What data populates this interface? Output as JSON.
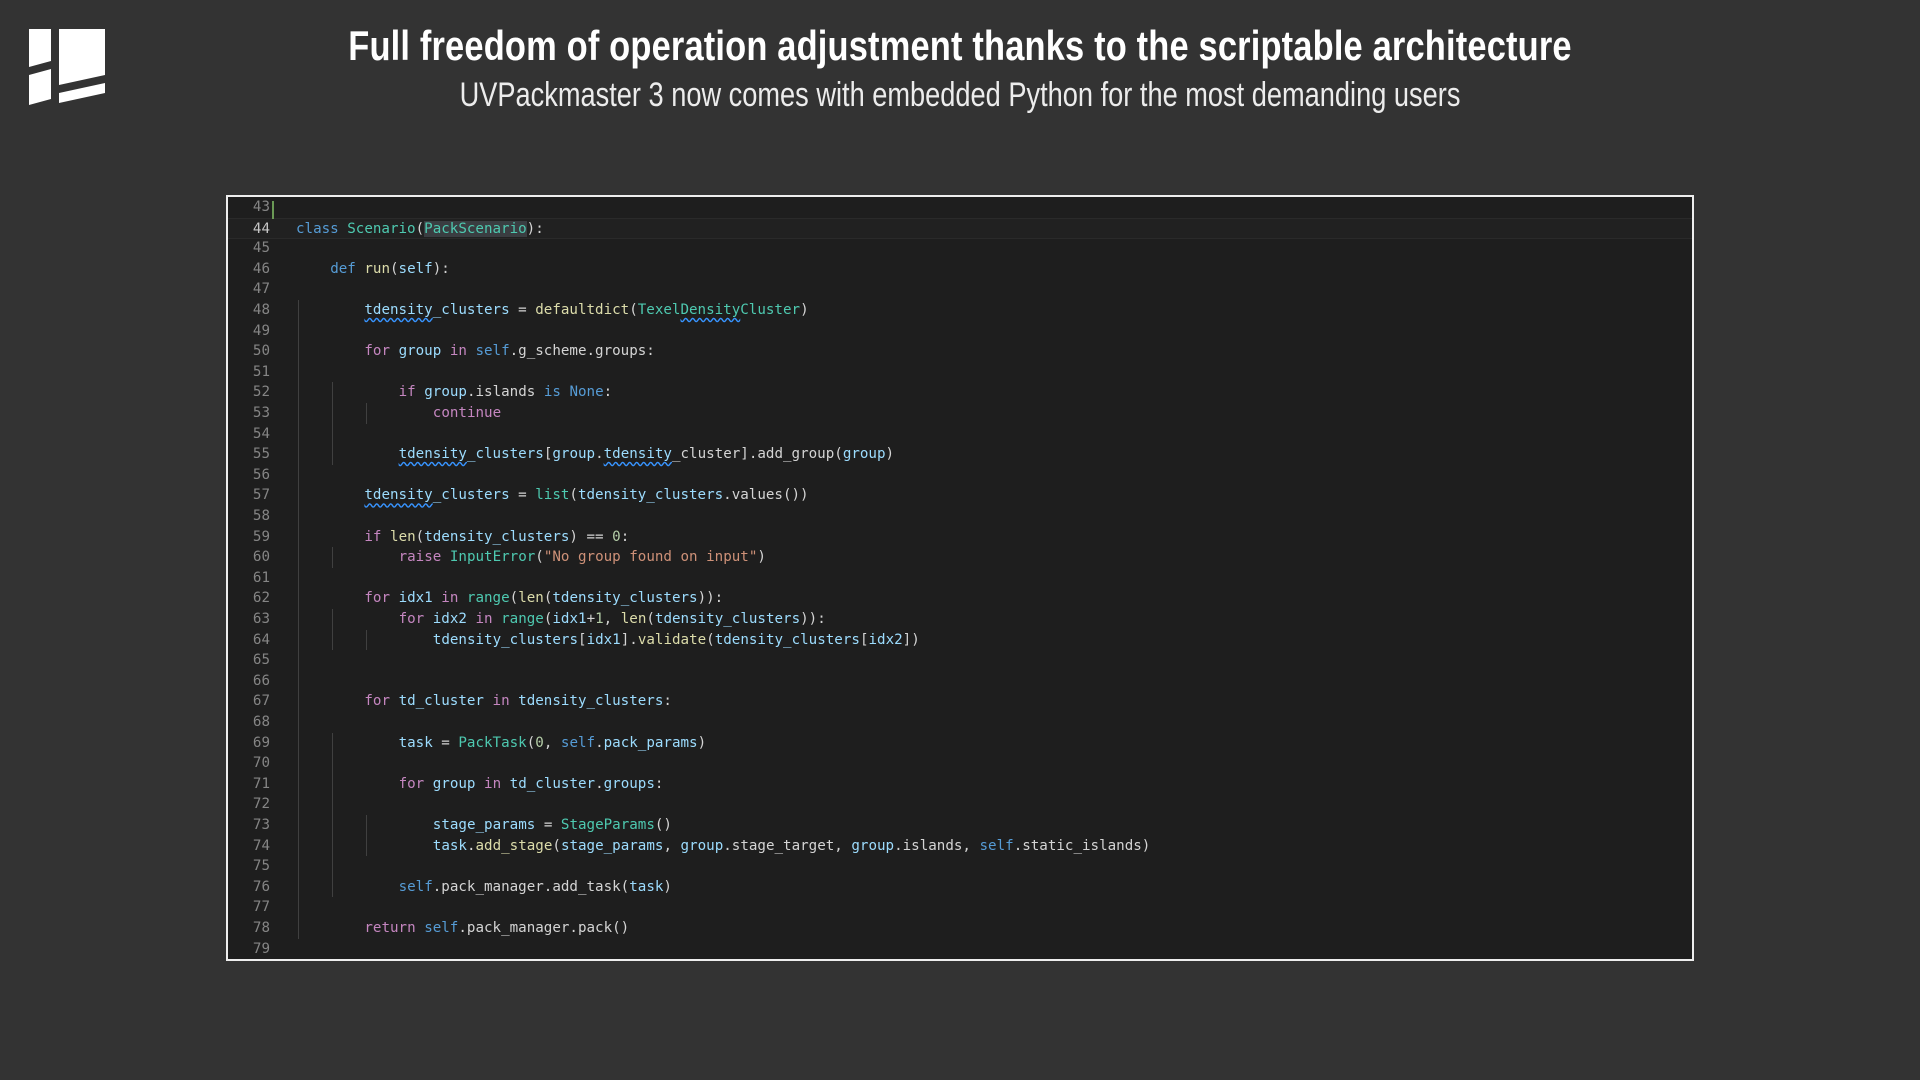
{
  "header": {
    "title": "Full freedom of operation adjustment thanks to the scriptable architecture",
    "subtitle": "UVPackmaster 3 now comes with embedded Python for the most demanding users"
  },
  "logo": {
    "icon": "uvpackmaster-logo-icon",
    "color": "#ffffff"
  },
  "editor": {
    "active_line": "44",
    "lines": [
      {
        "n": "43",
        "indent": 0,
        "tokens": []
      },
      {
        "n": "44",
        "indent": 0,
        "tokens": [
          [
            "kw",
            "class"
          ],
          [
            "pun",
            " "
          ],
          [
            "cls",
            "Scenario"
          ],
          [
            "pun",
            "("
          ],
          [
            "cls hl",
            "PackScenario"
          ],
          [
            "pun",
            "):"
          ]
        ]
      },
      {
        "n": "45",
        "indent": 0,
        "tokens": []
      },
      {
        "n": "46",
        "indent": 1,
        "tokens": [
          [
            "kw",
            "def"
          ],
          [
            "pun",
            " "
          ],
          [
            "fn",
            "run"
          ],
          [
            "pun",
            "("
          ],
          [
            "var",
            "self"
          ],
          [
            "pun",
            "):"
          ]
        ]
      },
      {
        "n": "47",
        "indent": 0,
        "tokens": []
      },
      {
        "n": "48",
        "indent": 2,
        "tokens": [
          [
            "var sq",
            "tdensity"
          ],
          [
            "var",
            "_clusters"
          ],
          [
            "pun",
            " = "
          ],
          [
            "fn",
            "defaultdict"
          ],
          [
            "pun",
            "("
          ],
          [
            "cls",
            "Texel"
          ],
          [
            "cls sq",
            "Density"
          ],
          [
            "cls",
            "Cluster"
          ],
          [
            "pun",
            ")"
          ]
        ]
      },
      {
        "n": "49",
        "indent": 0,
        "tokens": []
      },
      {
        "n": "50",
        "indent": 2,
        "tokens": [
          [
            "ctl",
            "for"
          ],
          [
            "pun",
            " "
          ],
          [
            "var",
            "group"
          ],
          [
            "pun",
            " "
          ],
          [
            "ctl",
            "in"
          ],
          [
            "pun",
            " "
          ],
          [
            "kw",
            "self"
          ],
          [
            "pun",
            ".g_scheme.groups:"
          ]
        ]
      },
      {
        "n": "51",
        "indent": 0,
        "tokens": []
      },
      {
        "n": "52",
        "indent": 3,
        "tokens": [
          [
            "ctl",
            "if"
          ],
          [
            "pun",
            " "
          ],
          [
            "var",
            "group"
          ],
          [
            "pun",
            ".islands "
          ],
          [
            "kw",
            "is"
          ],
          [
            "pun",
            " "
          ],
          [
            "kw",
            "None"
          ],
          [
            "pun",
            ":"
          ]
        ]
      },
      {
        "n": "53",
        "indent": 4,
        "tokens": [
          [
            "ctl",
            "continue"
          ]
        ]
      },
      {
        "n": "54",
        "indent": 0,
        "tokens": []
      },
      {
        "n": "55",
        "indent": 3,
        "tokens": [
          [
            "var sq",
            "tdensity"
          ],
          [
            "var",
            "_clusters"
          ],
          [
            "pun",
            "["
          ],
          [
            "var",
            "group"
          ],
          [
            "pun",
            "."
          ],
          [
            "var sq",
            "tdensity"
          ],
          [
            "pun",
            "_cluster].add_group("
          ],
          [
            "var",
            "group"
          ],
          [
            "pun",
            ")"
          ]
        ]
      },
      {
        "n": "56",
        "indent": 0,
        "tokens": []
      },
      {
        "n": "57",
        "indent": 2,
        "tokens": [
          [
            "var sq",
            "tdensity"
          ],
          [
            "var",
            "_clusters"
          ],
          [
            "pun",
            " = "
          ],
          [
            "cls",
            "list"
          ],
          [
            "pun",
            "("
          ],
          [
            "var",
            "tdensity_clusters"
          ],
          [
            "pun",
            ".values())"
          ]
        ]
      },
      {
        "n": "58",
        "indent": 0,
        "tokens": []
      },
      {
        "n": "59",
        "indent": 2,
        "tokens": [
          [
            "ctl",
            "if"
          ],
          [
            "pun",
            " "
          ],
          [
            "fn",
            "len"
          ],
          [
            "pun",
            "("
          ],
          [
            "var",
            "tdensity_clusters"
          ],
          [
            "pun",
            ") == "
          ],
          [
            "num",
            "0"
          ],
          [
            "pun",
            ":"
          ]
        ]
      },
      {
        "n": "60",
        "indent": 3,
        "tokens": [
          [
            "ctl",
            "raise"
          ],
          [
            "pun",
            " "
          ],
          [
            "cls",
            "InputError"
          ],
          [
            "pun",
            "("
          ],
          [
            "str",
            "\"No group found on input\""
          ],
          [
            "pun",
            ")"
          ]
        ]
      },
      {
        "n": "61",
        "indent": 0,
        "tokens": []
      },
      {
        "n": "62",
        "indent": 2,
        "tokens": [
          [
            "ctl",
            "for"
          ],
          [
            "pun",
            " "
          ],
          [
            "var",
            "idx1"
          ],
          [
            "pun",
            " "
          ],
          [
            "ctl",
            "in"
          ],
          [
            "pun",
            " "
          ],
          [
            "cls",
            "range"
          ],
          [
            "pun",
            "("
          ],
          [
            "fn",
            "len"
          ],
          [
            "pun",
            "("
          ],
          [
            "var",
            "tdensity_clusters"
          ],
          [
            "pun",
            "))"
          ],
          [
            "pun",
            ":"
          ]
        ]
      },
      {
        "n": "63",
        "indent": 3,
        "tokens": [
          [
            "ctl",
            "for"
          ],
          [
            "pun",
            " "
          ],
          [
            "var",
            "idx2"
          ],
          [
            "pun",
            " "
          ],
          [
            "ctl",
            "in"
          ],
          [
            "pun",
            " "
          ],
          [
            "cls",
            "range"
          ],
          [
            "pun",
            "("
          ],
          [
            "var",
            "idx1"
          ],
          [
            "pun",
            "+"
          ],
          [
            "num",
            "1"
          ],
          [
            "pun",
            ", "
          ],
          [
            "fn",
            "len"
          ],
          [
            "pun",
            "("
          ],
          [
            "var",
            "tdensity_clusters"
          ],
          [
            "pun",
            "))"
          ],
          [
            "pun",
            ":"
          ]
        ]
      },
      {
        "n": "64",
        "indent": 4,
        "tokens": [
          [
            "var",
            "tdensity_clusters"
          ],
          [
            "pun",
            "["
          ],
          [
            "var",
            "idx1"
          ],
          [
            "pun",
            "]."
          ],
          [
            "fn",
            "validate"
          ],
          [
            "pun",
            "("
          ],
          [
            "var",
            "tdensity_clusters"
          ],
          [
            "pun",
            "["
          ],
          [
            "var",
            "idx2"
          ],
          [
            "pun",
            "])"
          ]
        ]
      },
      {
        "n": "65",
        "indent": 0,
        "tokens": []
      },
      {
        "n": "66",
        "indent": 0,
        "tokens": []
      },
      {
        "n": "67",
        "indent": 2,
        "tokens": [
          [
            "ctl",
            "for"
          ],
          [
            "pun",
            " "
          ],
          [
            "var",
            "td_cluster"
          ],
          [
            "pun",
            " "
          ],
          [
            "ctl",
            "in"
          ],
          [
            "pun",
            " "
          ],
          [
            "var",
            "tdensity_clusters"
          ],
          [
            "pun",
            ":"
          ]
        ]
      },
      {
        "n": "68",
        "indent": 0,
        "tokens": []
      },
      {
        "n": "69",
        "indent": 3,
        "tokens": [
          [
            "var",
            "task"
          ],
          [
            "pun",
            " = "
          ],
          [
            "cls",
            "PackTask"
          ],
          [
            "pun",
            "("
          ],
          [
            "num",
            "0"
          ],
          [
            "pun",
            ", "
          ],
          [
            "kw",
            "self"
          ],
          [
            "pun",
            "."
          ],
          [
            "var",
            "pack_params"
          ],
          [
            "pun",
            ")"
          ]
        ]
      },
      {
        "n": "70",
        "indent": 0,
        "tokens": []
      },
      {
        "n": "71",
        "indent": 3,
        "tokens": [
          [
            "ctl",
            "for"
          ],
          [
            "pun",
            " "
          ],
          [
            "var",
            "group"
          ],
          [
            "pun",
            " "
          ],
          [
            "ctl",
            "in"
          ],
          [
            "pun",
            " "
          ],
          [
            "var",
            "td_cluster"
          ],
          [
            "pun",
            "."
          ],
          [
            "var",
            "groups"
          ],
          [
            "pun",
            ":"
          ]
        ]
      },
      {
        "n": "72",
        "indent": 0,
        "tokens": []
      },
      {
        "n": "73",
        "indent": 4,
        "tokens": [
          [
            "var",
            "stage_params"
          ],
          [
            "pun",
            " = "
          ],
          [
            "cls",
            "StageParams"
          ],
          [
            "pun",
            "()"
          ]
        ]
      },
      {
        "n": "74",
        "indent": 4,
        "tokens": [
          [
            "var",
            "task"
          ],
          [
            "pun",
            "."
          ],
          [
            "fn",
            "add_stage"
          ],
          [
            "pun",
            "("
          ],
          [
            "var",
            "stage_params"
          ],
          [
            "pun",
            ", "
          ],
          [
            "var",
            "group"
          ],
          [
            "pun",
            ".stage_target, "
          ],
          [
            "var",
            "group"
          ],
          [
            "pun",
            ".islands, "
          ],
          [
            "kw",
            "self"
          ],
          [
            "pun",
            ".static_islands)"
          ]
        ]
      },
      {
        "n": "75",
        "indent": 0,
        "tokens": []
      },
      {
        "n": "76",
        "indent": 3,
        "tokens": [
          [
            "kw",
            "self"
          ],
          [
            "pun",
            ".pack_manager.add_task("
          ],
          [
            "var",
            "task"
          ],
          [
            "pun",
            ")"
          ]
        ]
      },
      {
        "n": "77",
        "indent": 0,
        "tokens": []
      },
      {
        "n": "78",
        "indent": 2,
        "tokens": [
          [
            "ctl",
            "return"
          ],
          [
            "pun",
            " "
          ],
          [
            "kw",
            "self"
          ],
          [
            "pun",
            ".pack_manager.pack()"
          ]
        ]
      },
      {
        "n": "79",
        "indent": 0,
        "tokens": []
      }
    ]
  }
}
